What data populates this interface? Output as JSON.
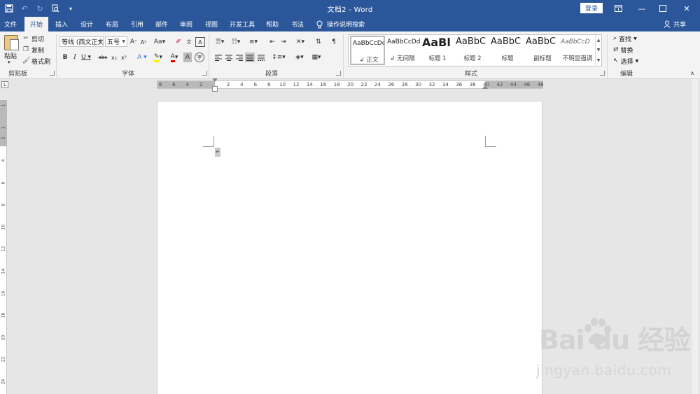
{
  "titlebar": {
    "title": "文档2  -  Word",
    "login_label": "登录",
    "bg_color": "#2b579a"
  },
  "tabs": [
    {
      "label": "文件"
    },
    {
      "label": "开始",
      "active": true
    },
    {
      "label": "插入"
    },
    {
      "label": "设计"
    },
    {
      "label": "布局"
    },
    {
      "label": "引用"
    },
    {
      "label": "邮件"
    },
    {
      "label": "审阅"
    },
    {
      "label": "视图"
    },
    {
      "label": "开发工具"
    },
    {
      "label": "帮助"
    },
    {
      "label": "书法"
    }
  ],
  "tell_me": {
    "label": "操作说明搜索"
  },
  "share": {
    "label": "共享"
  },
  "clipboard": {
    "paste_label": "粘贴",
    "cut_label": "剪切",
    "copy_label": "复制",
    "format_painter_label": "格式刷",
    "group_label": "剪贴板"
  },
  "font": {
    "font_name": "等线 (西文正文)",
    "font_size": "五号",
    "group_label": "字体"
  },
  "paragraph": {
    "group_label": "段落"
  },
  "styles": {
    "group_label": "样式",
    "items": [
      {
        "preview": "AaBbCcDd",
        "name": "↲ 正文",
        "selected": true
      },
      {
        "preview": "AaBbCcDd",
        "name": "↲ 无间隔"
      },
      {
        "preview": "AaBl",
        "name": "标题 1"
      },
      {
        "preview": "AaBbC",
        "name": "标题 2"
      },
      {
        "preview": "AaBbC",
        "name": "标题"
      },
      {
        "preview": "AaBbC",
        "name": "副标题"
      },
      {
        "preview": "AaBbCcD",
        "name": "不明显强调"
      }
    ]
  },
  "editing": {
    "find_label": "查找",
    "replace_label": "替换",
    "select_label": "选择",
    "group_label": "编辑"
  },
  "ruler": {
    "h_numbers": [
      "8",
      "6",
      "4",
      "2",
      "",
      "2",
      "4",
      "6",
      "8",
      "10",
      "12",
      "14",
      "16",
      "18",
      "20",
      "22",
      "24",
      "26",
      "28",
      "30",
      "32",
      "34",
      "36",
      "38",
      "40",
      "42",
      "44",
      "46",
      "48"
    ],
    "v_numbers": [
      "1",
      "",
      "1",
      "2",
      "",
      "4",
      "",
      "6",
      "",
      "8",
      "",
      "10",
      "",
      "12",
      "",
      "14",
      "",
      "16",
      "",
      "18",
      "",
      "20",
      "",
      "22",
      "",
      "24"
    ]
  },
  "document": {
    "paragraph_mark": "↵"
  },
  "watermark": {
    "logo_text": "Bai du 经验",
    "url_text": "jingyan.baidu.com"
  }
}
